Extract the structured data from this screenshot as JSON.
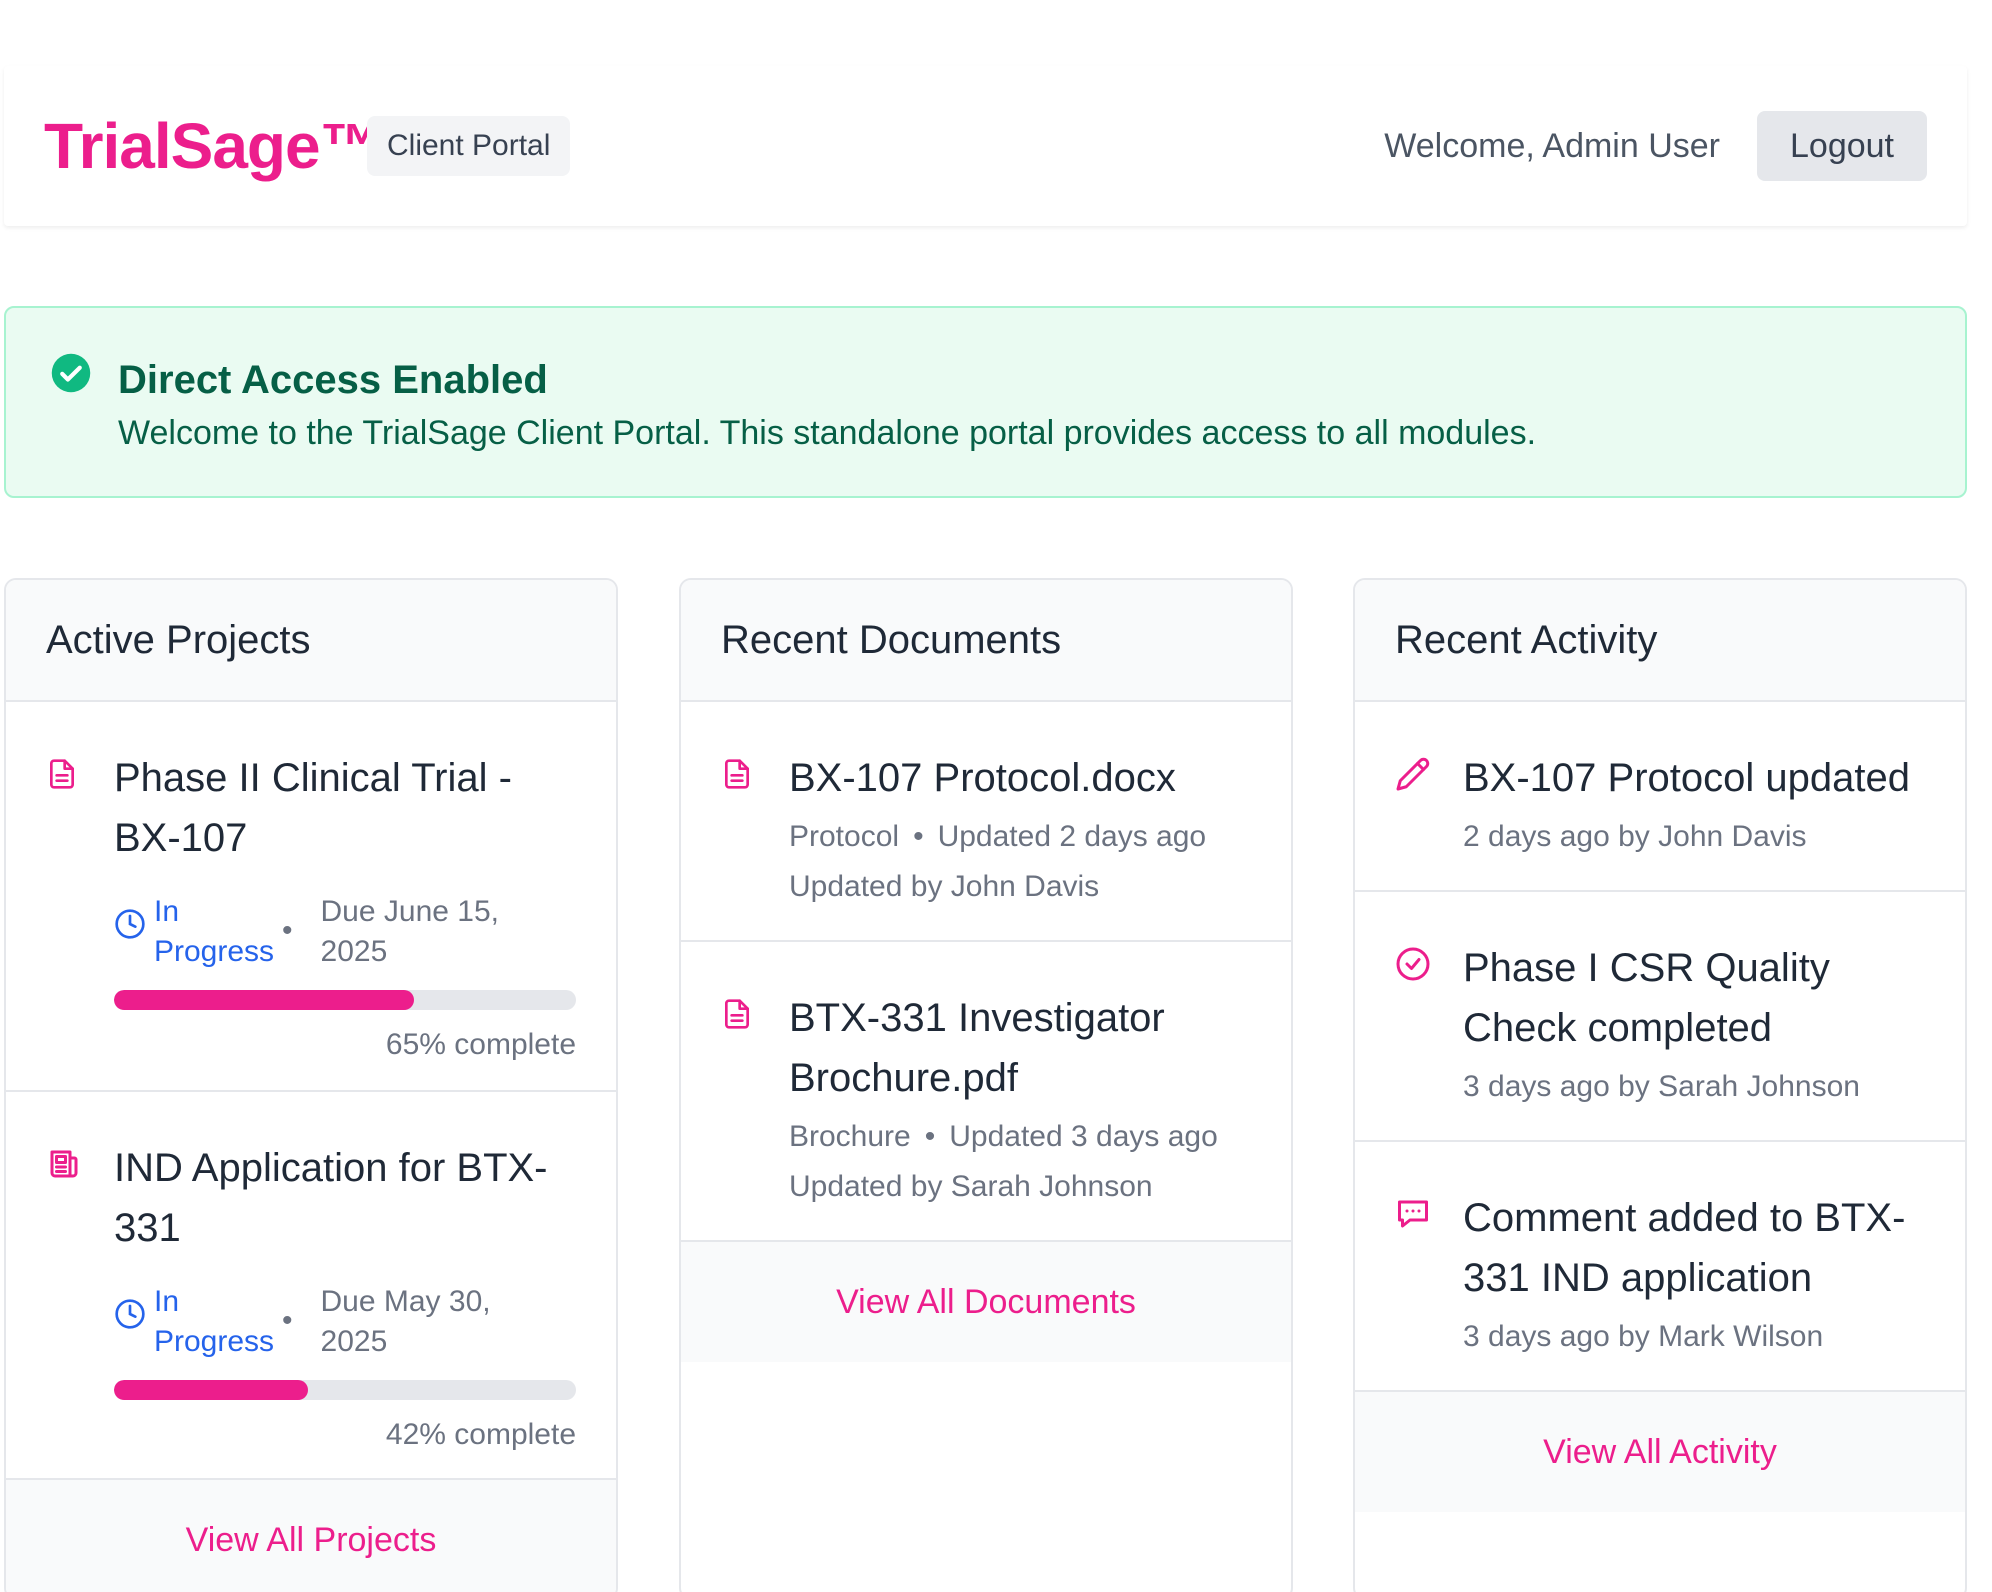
{
  "header": {
    "brand": "TrialSage™",
    "badge": "Client Portal",
    "welcome": "Welcome, Admin User",
    "logout_label": "Logout"
  },
  "alert": {
    "title": "Direct Access Enabled",
    "message": "Welcome to the TrialSage Client Portal. This standalone portal provides access to all modules."
  },
  "projects": {
    "title": "Active Projects",
    "items": [
      {
        "title": "Phase II Clinical Trial - BX-107",
        "icon": "document-icon",
        "status": "In Progress",
        "due": "Due June 15, 2025",
        "progress": 65,
        "progress_label": "65% complete"
      },
      {
        "title": "IND Application for BTX-331",
        "icon": "newspaper-icon",
        "status": "In Progress",
        "due": "Due May 30, 2025",
        "progress": 42,
        "progress_label": "42% complete"
      }
    ],
    "footer": "View All Projects"
  },
  "documents": {
    "title": "Recent Documents",
    "items": [
      {
        "title": "BX-107 Protocol.docx",
        "type": "Protocol",
        "updated": "Updated 2 days ago",
        "by": "Updated by John Davis"
      },
      {
        "title": "BTX-331 Investigator Brochure.pdf",
        "type": "Brochure",
        "updated": "Updated 3 days ago",
        "by": "Updated by Sarah Johnson"
      }
    ],
    "footer": "View All Documents"
  },
  "activity": {
    "title": "Recent Activity",
    "items": [
      {
        "title": "BX-107 Protocol updated",
        "icon": "pencil-icon",
        "meta": "2 days ago by John Davis"
      },
      {
        "title": "Phase I CSR Quality Check completed",
        "icon": "check-circle-icon",
        "meta": "3 days ago by Sarah Johnson"
      },
      {
        "title": "Comment added to BTX-331 IND application",
        "icon": "chat-icon",
        "meta": "3 days ago by Mark Wilson"
      }
    ],
    "footer": "View All Activity"
  },
  "colors": {
    "accent": "#ec1e8c",
    "status_blue": "#2563eb",
    "success_green": "#10b981"
  }
}
